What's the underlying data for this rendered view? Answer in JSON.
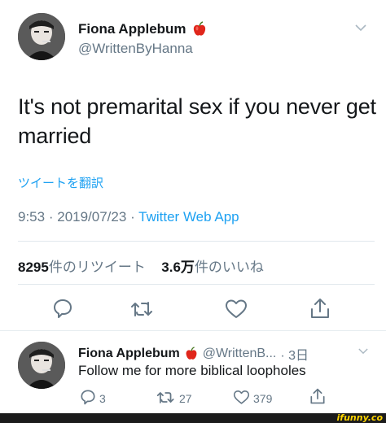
{
  "tweet": {
    "author_name": "Fiona Applebum",
    "author_emoji": "🍎",
    "handle": "@WrittenByHanna",
    "text_line1": "It's not premarital sex if you never get",
    "text_line2": "married",
    "translate_label": "ツイートを翻訳",
    "time": "9:53",
    "date": "2019/07/23",
    "separator": "·",
    "source": "Twitter Web App",
    "retweet_count": "8295",
    "retweet_label": "件のリツイート",
    "like_count": "3.6万",
    "like_label": "件のいいね"
  },
  "reply": {
    "author_name": "Fiona Applebum",
    "handle": "@WrittenB...",
    "age": "· 3日",
    "text": "Follow me for more biblical loopholes",
    "reply_count": "3",
    "retweet_count": "27",
    "like_count": "379"
  },
  "watermark": "ifunny.co",
  "colors": {
    "accent": "#1da1f2",
    "apple_red": "#e0261b"
  },
  "icons": [
    "chevron-down-icon",
    "reply-icon",
    "retweet-icon",
    "like-icon",
    "share-icon",
    "apple-icon"
  ]
}
